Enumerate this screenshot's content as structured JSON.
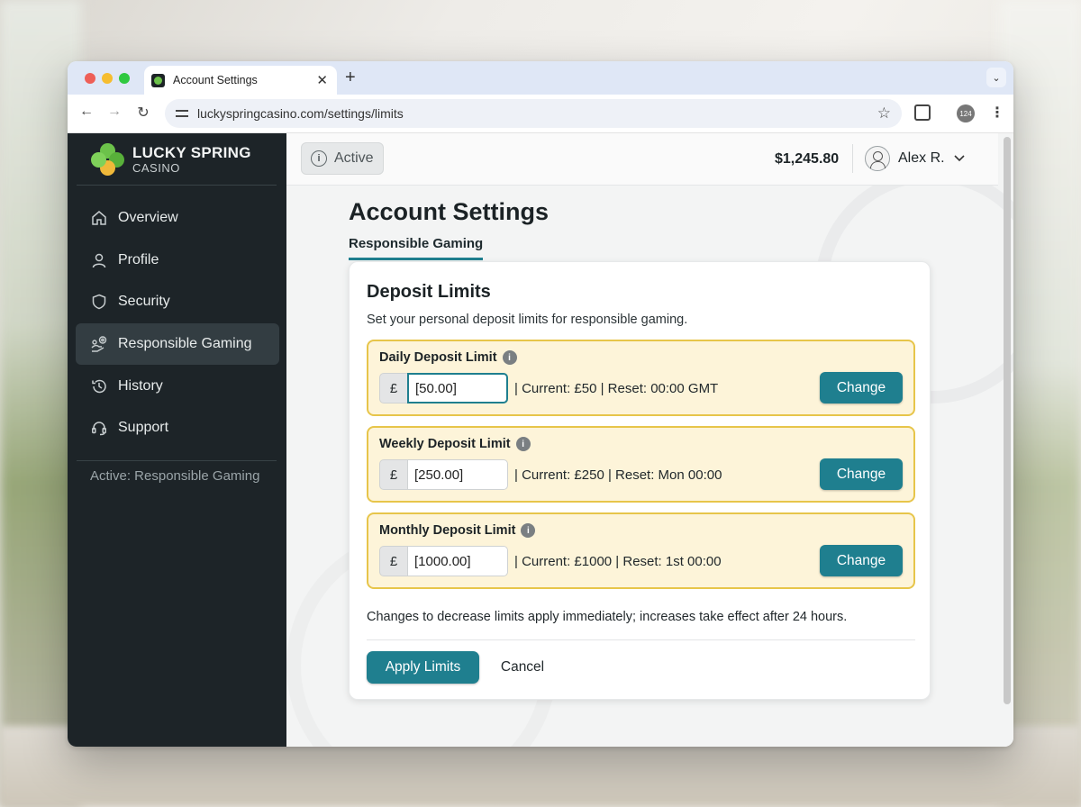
{
  "browser": {
    "tab_title": "Account Settings",
    "tab_close": "✕",
    "new_tab": "+",
    "url": "luckyspringcasino.com/settings/limits",
    "profile_count": "124"
  },
  "brand": {
    "name_line1": "LUCKY SPRING",
    "name_line2": "CASINO",
    "logo_colors": [
      "#6cc24a",
      "#58b03a",
      "#f0b93a",
      "#7fd15a"
    ]
  },
  "sidebar": {
    "items": [
      {
        "label": "Overview",
        "icon": "home-icon",
        "active": false
      },
      {
        "label": "Profile",
        "icon": "user-icon",
        "active": false
      },
      {
        "label": "Security",
        "icon": "shield-icon",
        "active": false
      },
      {
        "label": "Responsible Gaming",
        "icon": "responsible-gaming-icon",
        "active": true
      },
      {
        "label": "History",
        "icon": "history-icon",
        "active": false
      },
      {
        "label": "Support",
        "icon": "headset-icon",
        "active": false
      }
    ],
    "status_text": "Active: Responsible Gaming"
  },
  "topbar": {
    "status_label": "Active",
    "balance": "$1,245.80",
    "user_name": "Alex R."
  },
  "page": {
    "title": "Account Settings",
    "subtab": "Responsible Gaming"
  },
  "card": {
    "title": "Deposit Limits",
    "description": "Set your personal deposit limits for responsible gaming.",
    "limits": [
      {
        "label": "Daily Deposit Limit",
        "currency": "£",
        "value": "[50.00]",
        "info": "| Current: £50 | Reset: 00:00 GMT",
        "button": "Change"
      },
      {
        "label": "Weekly Deposit Limit",
        "currency": "£",
        "value": "[250.00]",
        "info": "| Current: £250 | Reset: Mon 00:00",
        "button": "Change"
      },
      {
        "label": "Monthly Deposit Limit",
        "currency": "£",
        "value": "[1000.00]",
        "info": "| Current: £1000 | Reset: 1st 00:00",
        "button": "Change"
      }
    ],
    "note": "Changes to decrease limits apply immediately; increases take effect after 24 hours.",
    "apply_label": "Apply Limits",
    "cancel_label": "Cancel"
  },
  "colors": {
    "accent": "#1f7f8f",
    "sidebar_bg": "#1d2428",
    "limit_bg": "#fdf4d9",
    "limit_border": "#e7c54a"
  }
}
